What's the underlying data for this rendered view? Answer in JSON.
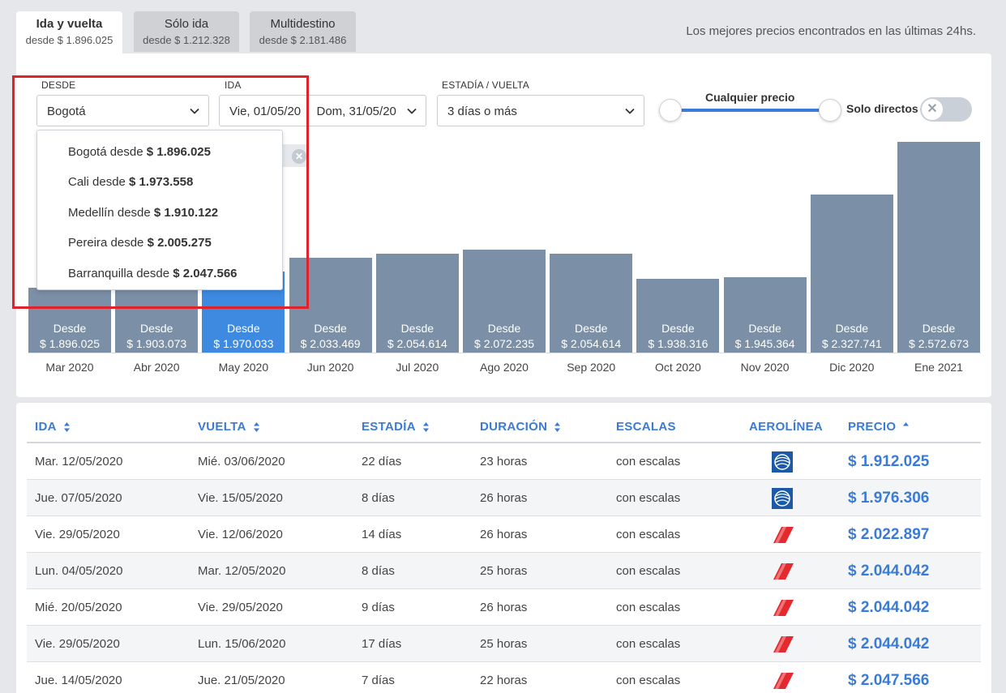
{
  "tabs": [
    {
      "label": "Ida y vuelta",
      "sub": "desde $ 1.896.025",
      "active": true
    },
    {
      "label": "Sólo ida",
      "sub": "desde $ 1.212.328",
      "active": false
    },
    {
      "label": "Multidestino",
      "sub": "desde $ 2.181.486",
      "active": false
    }
  ],
  "best_prices_note": "Los mejores precios encontrados en las últimas 24hs.",
  "filters": {
    "desde_label": "DESDE",
    "desde_value": "Bogotá",
    "ida_label": "IDA",
    "ida_value": "Vie, 01/05/20",
    "vuelta_value": "Dom, 31/05/20",
    "estadia_label": "ESTADÍA / VUELTA",
    "estadia_value": "3 días o más",
    "price_label": "Cualquier precio",
    "direct_label": "Solo directos"
  },
  "dropdown": [
    {
      "city": "Bogotá desde ",
      "price": "$ 1.896.025"
    },
    {
      "city": "Cali desde ",
      "price": "$ 1.973.558"
    },
    {
      "city": "Medellín desde ",
      "price": "$ 1.910.122"
    },
    {
      "city": "Pereira desde ",
      "price": "$ 2.005.275"
    },
    {
      "city": "Barranquilla desde ",
      "price": "$ 2.047.566"
    }
  ],
  "chart": {
    "desde_word": "Desde",
    "months": [
      {
        "label": "Mar 2020",
        "price": "$ 1.896.025",
        "value": 1896025,
        "active": false
      },
      {
        "label": "Abr 2020",
        "price": "$ 1.903.073",
        "value": 1903073,
        "active": false
      },
      {
        "label": "May 2020",
        "price": "$ 1.970.033",
        "value": 1970033,
        "active": true
      },
      {
        "label": "Jun 2020",
        "price": "$ 2.033.469",
        "value": 2033469,
        "active": false
      },
      {
        "label": "Jul 2020",
        "price": "$ 2.054.614",
        "value": 2054614,
        "active": false
      },
      {
        "label": "Ago 2020",
        "price": "$ 2.072.235",
        "value": 2072235,
        "active": false
      },
      {
        "label": "Sep 2020",
        "price": "$ 2.054.614",
        "value": 2054614,
        "active": false
      },
      {
        "label": "Oct 2020",
        "price": "$ 1.938.316",
        "value": 1938316,
        "active": false
      },
      {
        "label": "Nov 2020",
        "price": "$ 1.945.364",
        "value": 1945364,
        "active": false
      },
      {
        "label": "Dic 2020",
        "price": "$ 2.327.741",
        "value": 2327741,
        "active": false
      },
      {
        "label": "Ene 2021",
        "price": "$ 2.572.673",
        "value": 2572673,
        "active": false
      }
    ]
  },
  "table": {
    "headers": [
      "IDA",
      "VUELTA",
      "ESTADÍA",
      "DURACIÓN",
      "ESCALAS",
      "AEROLÍNEA",
      "PRECIO"
    ],
    "rows": [
      {
        "ida": "Mar. 12/05/2020",
        "vuelta": "Mié. 03/06/2020",
        "estadia": "22 días",
        "duracion": "23 horas",
        "escalas": "con escalas",
        "airline": "united",
        "precio": "$ 1.912.025"
      },
      {
        "ida": "Jue. 07/05/2020",
        "vuelta": "Vie. 15/05/2020",
        "estadia": "8 días",
        "duracion": "26 horas",
        "escalas": "con escalas",
        "airline": "united",
        "precio": "$ 1.976.306"
      },
      {
        "ida": "Vie. 29/05/2020",
        "vuelta": "Vie. 12/06/2020",
        "estadia": "14 días",
        "duracion": "26 horas",
        "escalas": "con escalas",
        "airline": "avianca",
        "precio": "$ 2.022.897"
      },
      {
        "ida": "Lun. 04/05/2020",
        "vuelta": "Mar. 12/05/2020",
        "estadia": "8 días",
        "duracion": "25 horas",
        "escalas": "con escalas",
        "airline": "avianca",
        "precio": "$ 2.044.042"
      },
      {
        "ida": "Mié. 20/05/2020",
        "vuelta": "Vie. 29/05/2020",
        "estadia": "9 días",
        "duracion": "26 horas",
        "escalas": "con escalas",
        "airline": "avianca",
        "precio": "$ 2.044.042"
      },
      {
        "ida": "Vie. 29/05/2020",
        "vuelta": "Lun. 15/06/2020",
        "estadia": "17 días",
        "duracion": "25 horas",
        "escalas": "con escalas",
        "airline": "avianca",
        "precio": "$ 2.044.042"
      },
      {
        "ida": "Jue. 14/05/2020",
        "vuelta": "Jue. 21/05/2020",
        "estadia": "7 días",
        "duracion": "22 horas",
        "escalas": "con escalas",
        "airline": "avianca",
        "precio": "$ 2.047.566"
      }
    ]
  },
  "colors": {
    "accent": "#3a7bd5",
    "bar": "#7b8fa6",
    "bar_active": "#3d8ae0",
    "highlight": "#e0232b"
  }
}
